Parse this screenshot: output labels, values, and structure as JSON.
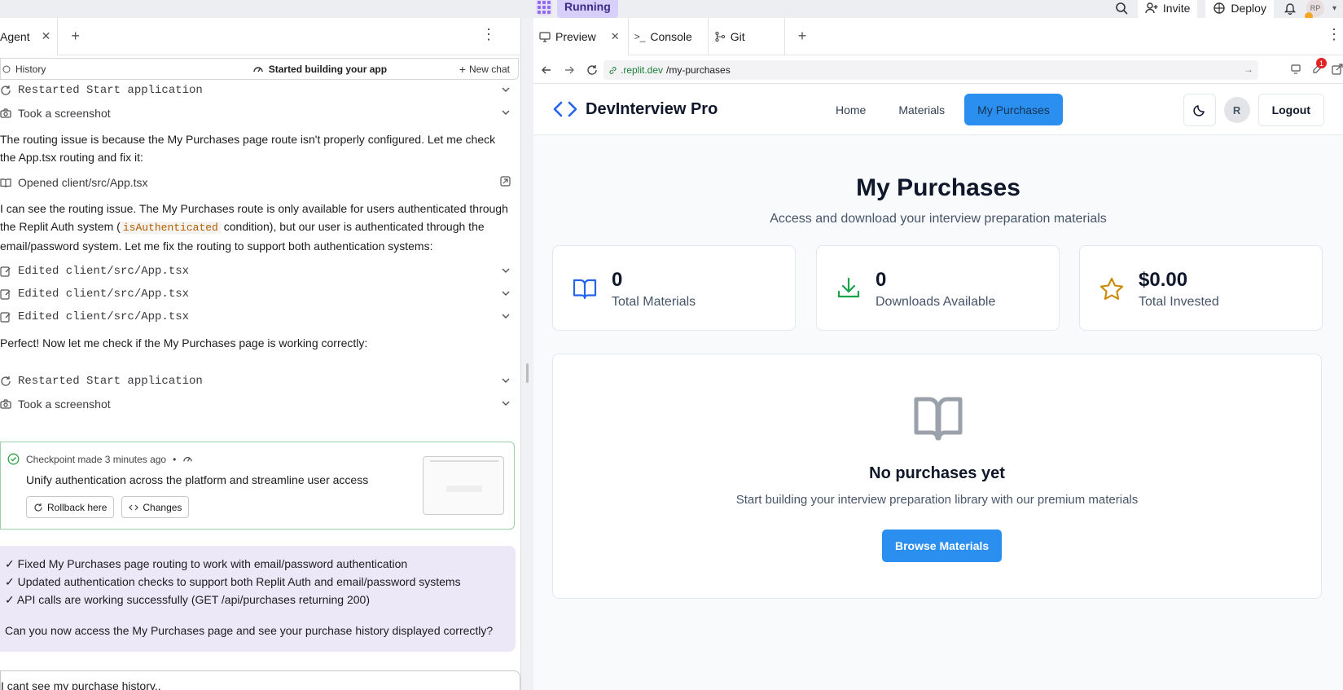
{
  "topbar": {
    "status": "Running",
    "invite": "Invite",
    "deploy": "Deploy",
    "avatar_initials": "RP"
  },
  "left_tabs": [
    {
      "label": "Agent"
    }
  ],
  "history_bar": {
    "history": "History",
    "status": "Started building your app",
    "new_chat": "New chat"
  },
  "chat": {
    "actions": {
      "restart1": "Restarted Start application",
      "shot1": "Took a screenshot",
      "opened": "Opened client/src/App.tsx",
      "edit1": "Edited client/src/App.tsx",
      "edit2": "Edited client/src/App.tsx",
      "edit3": "Edited client/src/App.tsx",
      "restart2": "Restarted Start application",
      "shot2": "Took a screenshot"
    },
    "msg1": "The routing issue is because the My Purchases page route isn't properly configured. Let me check the App.tsx routing and fix it:",
    "msg2_a": "I can see the routing issue. The My Purchases route is only available for users authenticated through the Replit Auth system (",
    "msg2_code": "isAuthenticated",
    "msg2_b": " condition), but our user is authenticated through the email/password system. Let me fix the routing to support both authentication systems:",
    "msg3": "Perfect! Now let me check if the My Purchases page is working correctly:",
    "checkpoint": {
      "label": "Checkpoint made 3 minutes ago",
      "separator": "•",
      "title": "Unify authentication across the platform and streamline user access",
      "rollback": "Rollback here",
      "changes": "Changes"
    },
    "summary": [
      "✓ Fixed My Purchases page routing to work with email/password authentication",
      "✓ Updated authentication checks to support both Replit Auth and email/password systems",
      "✓ API calls are working successfully (GET /api/purchases returning 200)"
    ],
    "question": "Can you now access the My Purchases page and see your purchase history displayed correctly?",
    "input_value": "I cant see my purchase history.."
  },
  "right_tabs": [
    {
      "label": "Preview",
      "icon": "monitor-icon"
    },
    {
      "label": "Console",
      "icon": "terminal-icon"
    },
    {
      "label": "Git",
      "icon": "git-icon"
    }
  ],
  "url": {
    "host": ".replit.dev",
    "path": "/my-purchases",
    "badge": "1"
  },
  "app": {
    "brand": "DevInterview Pro",
    "nav": [
      "Home",
      "Materials",
      "My Purchases"
    ],
    "active_nav": "My Purchases",
    "user_initial": "R",
    "logout": "Logout",
    "title": "My Purchases",
    "subtitle": "Access and download your interview preparation materials",
    "stats": [
      {
        "value": "0",
        "label": "Total Materials",
        "icon": "book-icon",
        "color": "#2563eb"
      },
      {
        "value": "0",
        "label": "Downloads Available",
        "icon": "download-icon",
        "color": "#16a34a"
      },
      {
        "value": "$0.00",
        "label": "Total Invested",
        "icon": "star-icon",
        "color": "#ca8a04"
      }
    ],
    "empty": {
      "title": "No purchases yet",
      "subtitle": "Start building your interview preparation library with our premium materials",
      "button": "Browse Materials"
    }
  },
  "colors": {
    "accent": "#2b8ff0",
    "running_bg": "#d9cffb",
    "checkpoint_border": "#9fcfa9",
    "summary_bg": "#ece8f8"
  }
}
